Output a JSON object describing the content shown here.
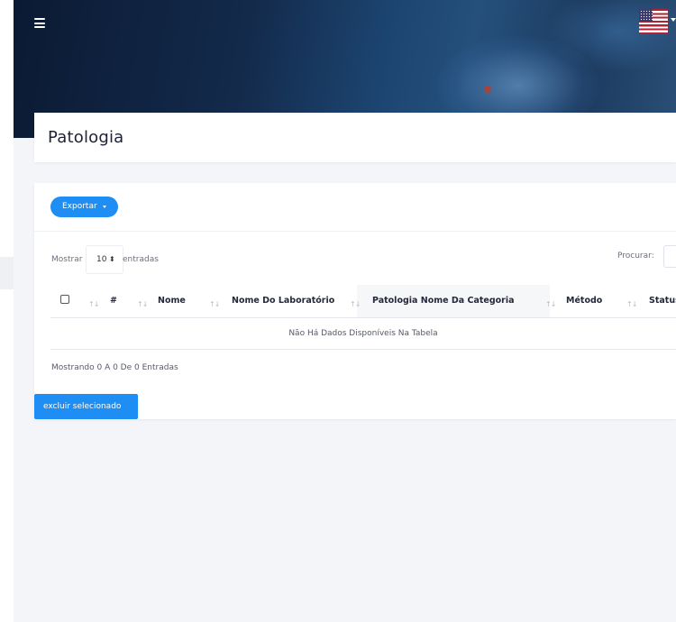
{
  "header": {
    "menu_icon": "hamburger-icon",
    "language_flag": "us-flag-icon"
  },
  "page": {
    "title": "Patologia"
  },
  "toolbar": {
    "export_label": "Exportar"
  },
  "table_controls": {
    "show_label": "Mostrar",
    "page_size": "10",
    "entries_label": "entradas",
    "search_label": "Procurar:",
    "search_value": ""
  },
  "table": {
    "columns": [
      "#",
      "Nome",
      "Nome Do Laboratório",
      "Patologia Nome Da Categoria",
      "Método",
      "Status"
    ],
    "empty_message": "Não Há Dados Disponíveis Na Tabela",
    "info": "Mostrando 0 A 0 De 0 Entradas"
  },
  "actions": {
    "delete_selected_label": "excluir selecionado"
  },
  "colors": {
    "accent": "#1e8ef5",
    "background": "#f4f5f9",
    "hero_dark": "#0b1a33"
  }
}
